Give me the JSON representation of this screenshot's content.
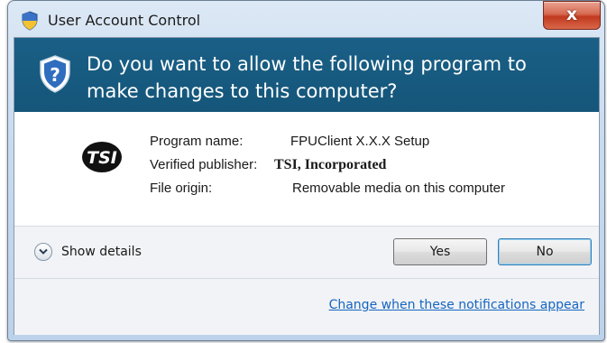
{
  "window": {
    "title": "User Account Control",
    "close_label": "x"
  },
  "banner": {
    "question": "Do you want to allow the following program to make changes to this computer?"
  },
  "details": {
    "publisher_logo": "TSI",
    "rows": [
      {
        "label": "Program name:",
        "value": "FPUClient X.X.X Setup"
      },
      {
        "label": "Verified publisher:",
        "value": "TSI, Incorporated"
      },
      {
        "label": "File origin:",
        "value": "Removable media on this computer"
      }
    ]
  },
  "actions": {
    "show_details_label": "Show details",
    "yes_label": "Yes",
    "no_label": "No"
  },
  "footer": {
    "link_label": "Change when these notifications appear"
  },
  "icons": {
    "title": "shield-icon",
    "banner": "shield-question-icon",
    "details_toggle": "chevron-down-icon",
    "publisher": "tsi-logo-icon"
  },
  "colors": {
    "banner_bg": "#1a5f86",
    "link": "#1565c0",
    "close_button": "#c1391e"
  }
}
